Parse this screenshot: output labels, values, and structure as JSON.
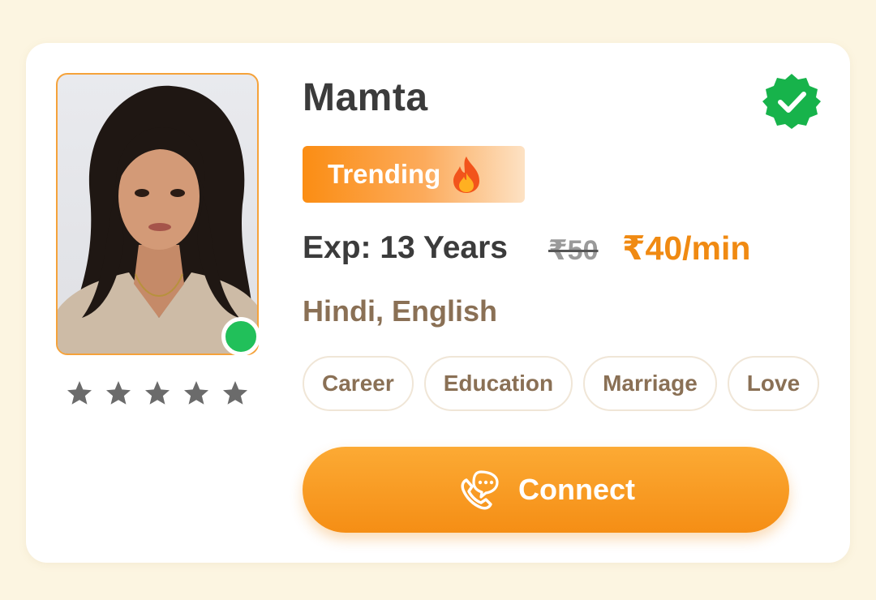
{
  "profile": {
    "name": "Mamta",
    "badge_label": "Trending",
    "badge_icon": "flame-icon",
    "experience": "Exp: 13 Years",
    "old_price": "₹50",
    "price": "₹40/min",
    "languages": "Hindi, English",
    "rating_stars": 5,
    "online": true,
    "verified": true
  },
  "tags": [
    "Career",
    "Education",
    "Marriage",
    "Love"
  ],
  "connect": {
    "label": "Connect",
    "icon": "call-chat-icon"
  },
  "colors": {
    "page_bg": "#fcf5e1",
    "accent": "#f58e15",
    "price": "#f08a12",
    "online": "#21c05a",
    "verified": "#17b34b",
    "star": "#6b6b6b",
    "muted_text": "#8a7055"
  }
}
